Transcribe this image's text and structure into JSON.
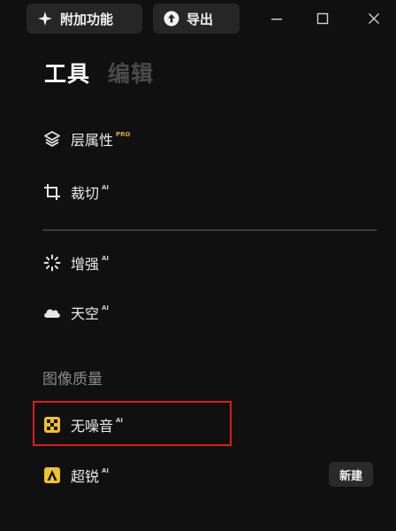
{
  "titlebar": {
    "addons_label": "附加功能",
    "export_label": "导出"
  },
  "tabs": [
    {
      "label": "工具",
      "active": true
    },
    {
      "label": "编辑",
      "active": false
    }
  ],
  "tools": [
    {
      "label": "层属性",
      "badge": "PRO",
      "icon": "layers-icon"
    },
    {
      "label": "裁切",
      "badge": "AI",
      "icon": "crop-icon"
    },
    {
      "label": "增强",
      "badge": "AI",
      "icon": "sparkle-burst-icon"
    },
    {
      "label": "天空",
      "badge": "AI",
      "icon": "cloud-icon"
    }
  ],
  "image_quality": {
    "section_title": "图像质量",
    "items": [
      {
        "label": "无噪音",
        "badge": "AI",
        "icon": "denoise-icon"
      },
      {
        "label": "超锐",
        "badge": "AI",
        "icon": "supersharp-icon"
      }
    ],
    "new_label": "新建"
  },
  "colors": {
    "accent_yellow": "#f0c22b",
    "pro_badge": "#d8a838",
    "highlight_box": "#e01b1b"
  }
}
